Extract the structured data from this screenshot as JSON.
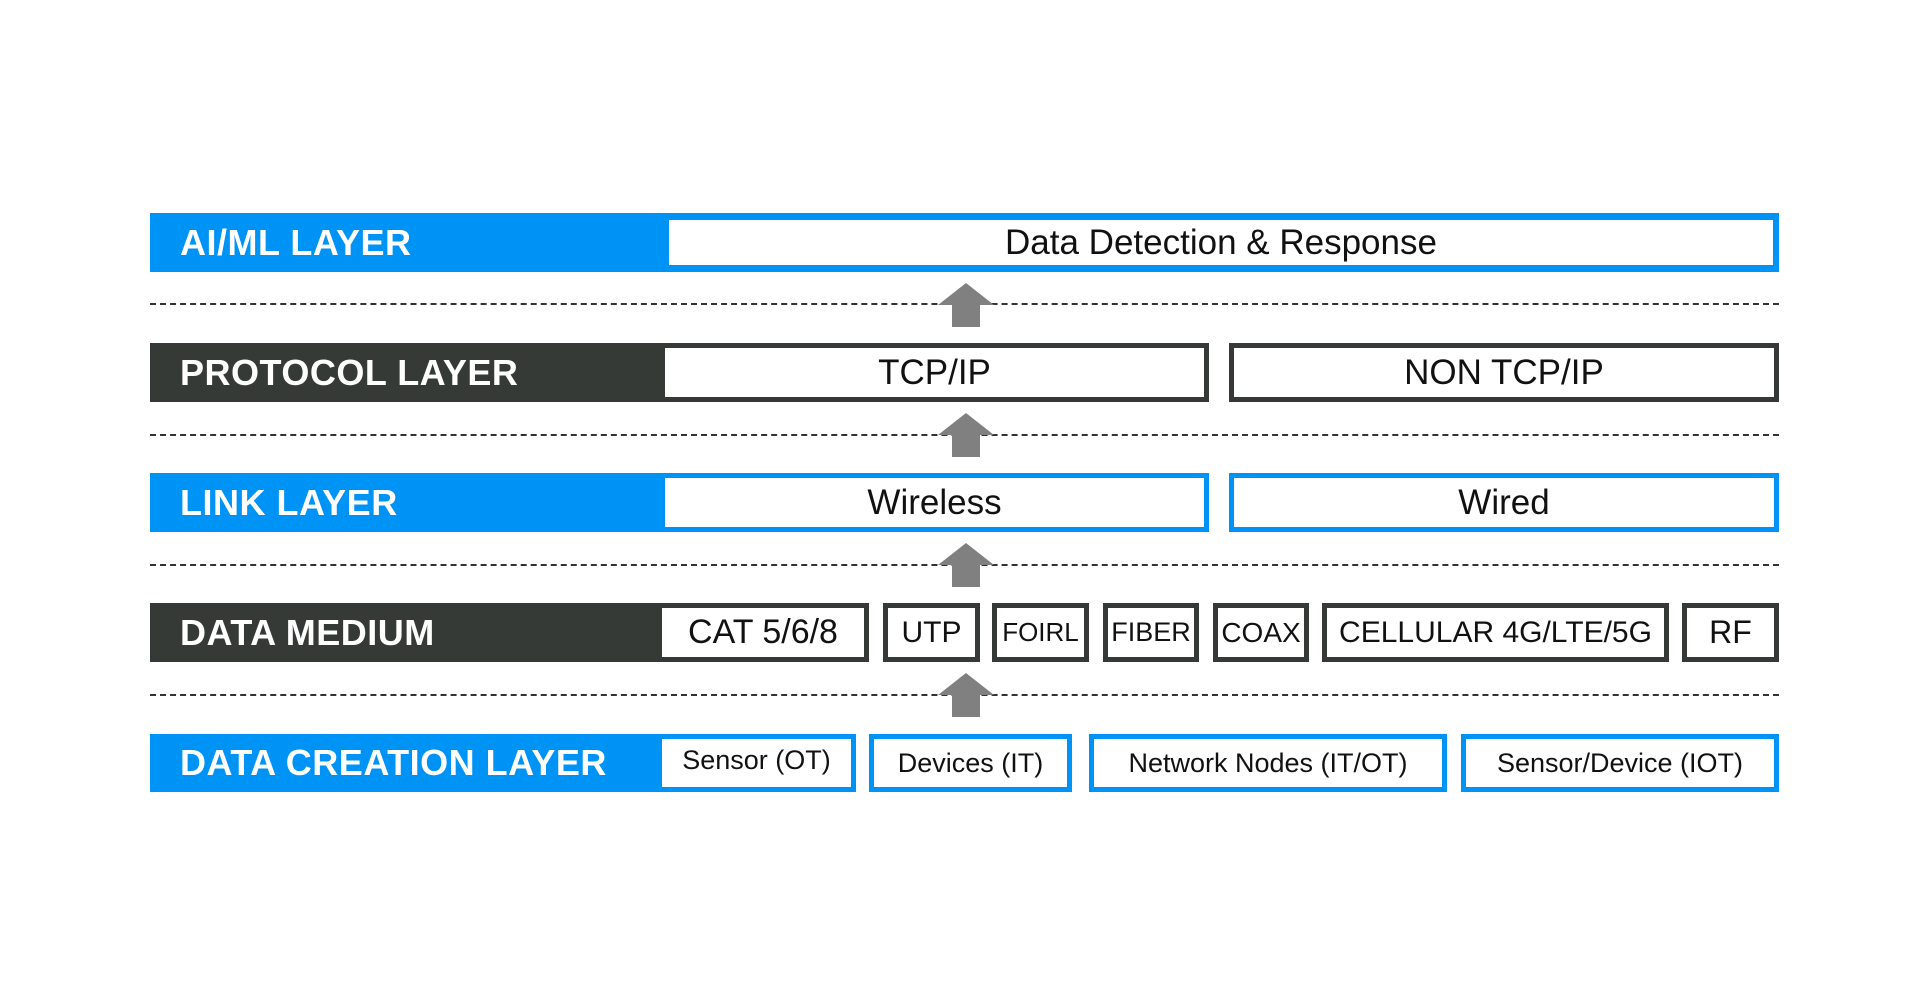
{
  "colors": {
    "blue": "#0093f6",
    "dark": "#363a37",
    "arrow": "#808080"
  },
  "layers": [
    {
      "label": "AI/ML LAYER",
      "items": [
        "Data Detection & Response"
      ]
    },
    {
      "label": "PROTOCOL LAYER",
      "items": [
        "TCP/IP",
        "NON TCP/IP"
      ]
    },
    {
      "label": "LINK LAYER",
      "items": [
        "Wireless",
        "Wired"
      ]
    },
    {
      "label": "DATA MEDIUM",
      "items": [
        "CAT 5/6/8",
        "UTP",
        "FOIRL",
        "FIBER",
        "COAX",
        "CELLULAR 4G/LTE/5G",
        "RF"
      ]
    },
    {
      "label": "DATA CREATION LAYER",
      "items": [
        "Sensor (OT)",
        "Devices (IT)",
        "Network Nodes (IT/OT)",
        "Sensor/Device (IOT)"
      ]
    }
  ]
}
